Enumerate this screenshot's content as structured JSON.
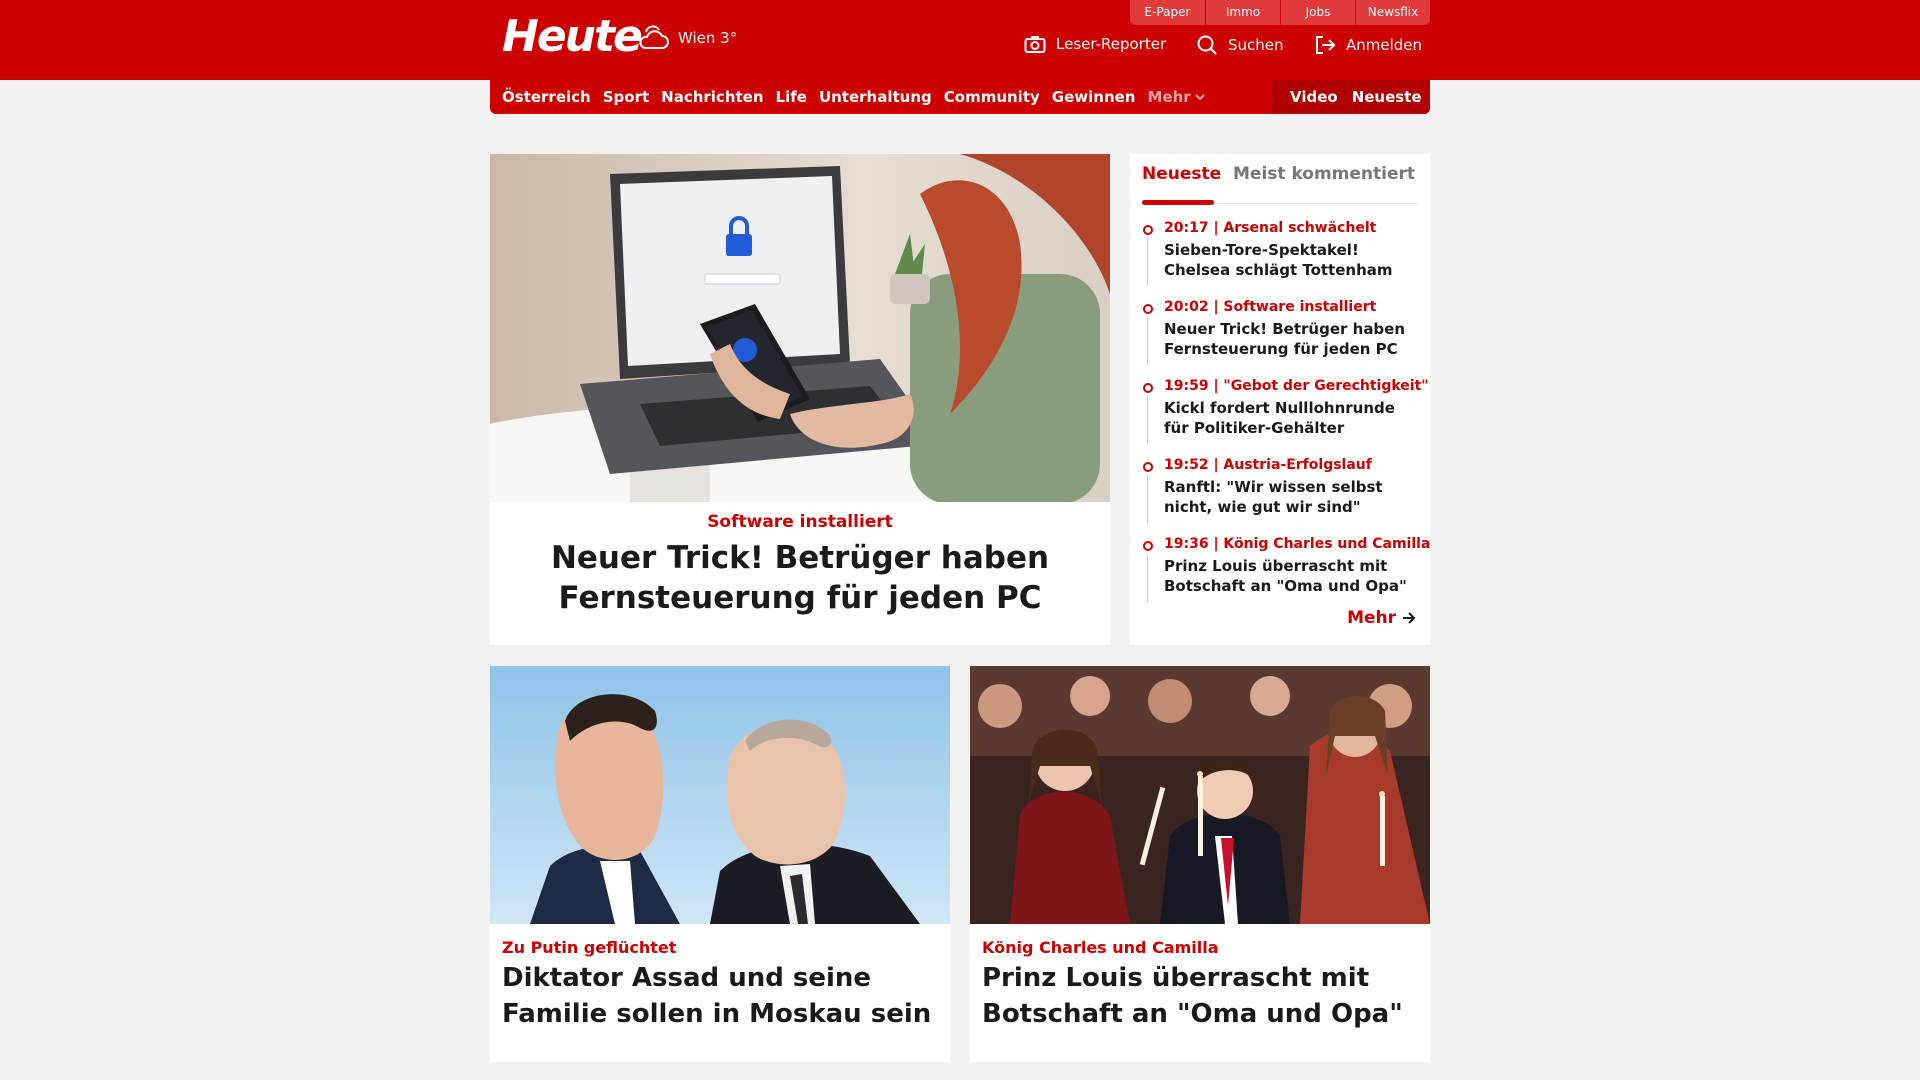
{
  "header": {
    "logo": "Heute",
    "weather": "Wien 3°",
    "service_links": [
      "E-Paper",
      "Immo",
      "Jobs",
      "Newsflix"
    ],
    "actions": {
      "leser_reporter": "Leser-Reporter",
      "search": "Suchen",
      "login": "Anmelden"
    }
  },
  "nav": {
    "items": [
      "Österreich",
      "Sport",
      "Nachrichten",
      "Life",
      "Unterhaltung",
      "Community",
      "Gewinnen"
    ],
    "more": "Mehr",
    "right": [
      "Video",
      "Neueste"
    ]
  },
  "hero": {
    "kicker": "Software installiert",
    "title": "Neuer Trick! Betrüger haben Fernsteuerung für jeden PC"
  },
  "sidebar": {
    "tab_active": "Neueste",
    "tab_inactive": "Meist kommentiert",
    "items": [
      {
        "meta": "20:17 | Arsenal schwächelt",
        "title": "Sieben-Tore-Spektakel! Chelsea schlägt Tottenham"
      },
      {
        "meta": "20:02 | Software installiert",
        "title": "Neuer Trick! Betrüger haben Fernsteuerung für jeden PC"
      },
      {
        "meta": "19:59 | \"Gebot der Gerechtigkeit\"",
        "title": "Kickl fordert Nulllohnrunde für Politiker-Gehälter"
      },
      {
        "meta": "19:52 | Austria-Erfolgslauf",
        "title": "Ranftl: \"Wir wissen selbst nicht, wie gut wir sind\""
      },
      {
        "meta": "19:36 | König Charles und Camilla",
        "title": "Prinz Louis überrascht mit Botschaft an \"Oma und Opa\""
      }
    ],
    "more": "Mehr"
  },
  "cards": [
    {
      "kicker": "Zu Putin geflüchtet",
      "title": "Diktator Assad und seine Familie sollen in Moskau sein"
    },
    {
      "kicker": "König Charles und Camilla",
      "title": "Prinz Louis überrascht mit Botschaft an \"Oma und Opa\""
    }
  ],
  "colors": {
    "brand_red": "#cc0000",
    "dark_red": "#b00000",
    "page_bg": "#f2f2f2"
  },
  "icons": [
    "weather-cloud-sun-icon",
    "camera-icon",
    "search-icon",
    "login-icon",
    "chevron-down-icon",
    "arrow-right-icon"
  ]
}
